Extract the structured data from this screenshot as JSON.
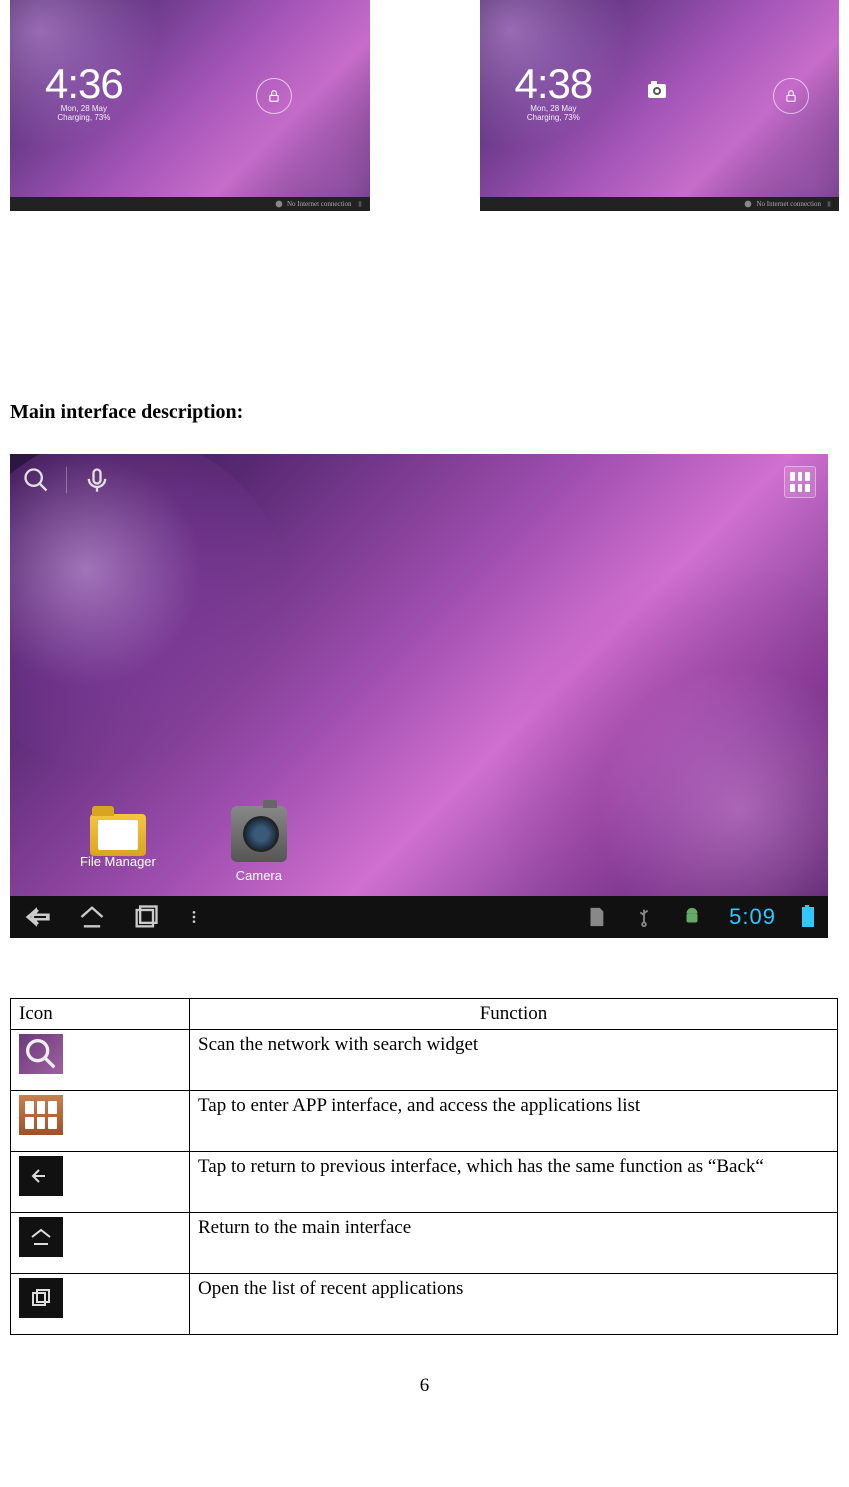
{
  "lock_screens": {
    "left": {
      "time": "4:36",
      "date": "Mon, 28 May",
      "status": "Charging, 73%",
      "bottom_status": "No Internet connection"
    },
    "right": {
      "time": "4:38",
      "date": "Mon, 28 May",
      "status": "Charging, 73%",
      "bottom_status": "No Internet connection"
    }
  },
  "section_heading": "Main interface description:",
  "home_screen": {
    "apps": [
      {
        "label": "File Manager",
        "icon": "folder-icon"
      },
      {
        "label": "Camera",
        "icon": "camera-icon"
      }
    ],
    "clock": "5:09"
  },
  "table": {
    "header_icon": "Icon",
    "header_function": "Function",
    "rows": [
      {
        "icon": "search-icon",
        "function": "Scan the network with search widget"
      },
      {
        "icon": "apps-grid-icon",
        "function": "Tap to enter APP interface, and access the applications list"
      },
      {
        "icon": "back-icon",
        "function": "Tap to return to previous interface, which has the same function as “Back“"
      },
      {
        "icon": "home-icon",
        "function": "Return to the main interface"
      },
      {
        "icon": "recent-apps-icon",
        "function": "Open the list of recent applications"
      }
    ]
  },
  "page_number": "6"
}
